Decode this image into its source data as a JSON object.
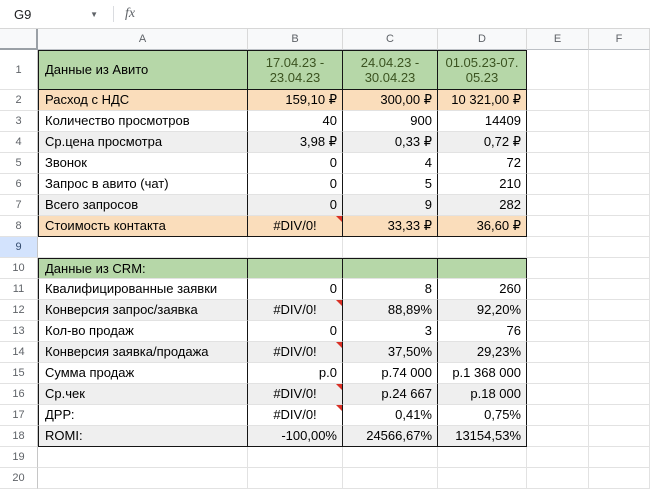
{
  "formula_bar": {
    "cell_reference": "G9",
    "fx_label": "fx"
  },
  "colors": {
    "header_green": "#b6d7a8",
    "highlight_peach": "#faddbb",
    "band_gray": "#efefef",
    "grid_line": "#e2e2e2",
    "selected_row_header": "#d3e3fd",
    "note_red": "#d93025",
    "date_text_green": "#3b5320",
    "block_border": "#151515"
  },
  "sheet": {
    "column_headers": [
      "A",
      "B",
      "C",
      "D",
      "E",
      "F"
    ],
    "selected_row": 9,
    "blocks": [
      {
        "start": 1,
        "end": 8
      },
      {
        "start": 10,
        "end": 18
      }
    ],
    "thick_underline_rows": [
      1
    ],
    "rows": [
      {
        "n": 1,
        "h": 40,
        "cells": {
          "A": {
            "t": "Данные из Авито",
            "bg": "green",
            "al": "l"
          },
          "B": {
            "t": "17.04.23 -\n23.04.23",
            "bg": "green",
            "al": "c",
            "tone": "date"
          },
          "C": {
            "t": "24.04.23 -\n30.04.23",
            "bg": "green",
            "al": "c",
            "tone": "date"
          },
          "D": {
            "t": "01.05.23-07.\n05.23",
            "bg": "green",
            "al": "c",
            "tone": "date"
          }
        }
      },
      {
        "n": 2,
        "cells": {
          "A": {
            "t": "Расход с НДС",
            "bg": "peach",
            "al": "l"
          },
          "B": {
            "t": "159,10 ₽",
            "bg": "peach",
            "al": "r"
          },
          "C": {
            "t": "300,00 ₽",
            "bg": "peach",
            "al": "r"
          },
          "D": {
            "t": "10 321,00 ₽",
            "bg": "peach",
            "al": "r"
          }
        }
      },
      {
        "n": 3,
        "cells": {
          "A": {
            "t": "Количество просмотров",
            "al": "l"
          },
          "B": {
            "t": "40",
            "al": "r"
          },
          "C": {
            "t": "900",
            "al": "r"
          },
          "D": {
            "t": "14409",
            "al": "r"
          }
        }
      },
      {
        "n": 4,
        "cells": {
          "A": {
            "t": "Ср.цена просмотра",
            "bg": "gray",
            "al": "l"
          },
          "B": {
            "t": "3,98 ₽",
            "bg": "gray",
            "al": "r"
          },
          "C": {
            "t": "0,33 ₽",
            "bg": "gray",
            "al": "r"
          },
          "D": {
            "t": "0,72 ₽",
            "bg": "gray",
            "al": "r"
          }
        }
      },
      {
        "n": 5,
        "cells": {
          "A": {
            "t": "Звонок",
            "al": "l"
          },
          "B": {
            "t": "0",
            "al": "r"
          },
          "C": {
            "t": "4",
            "al": "r"
          },
          "D": {
            "t": "72",
            "al": "r"
          }
        }
      },
      {
        "n": 6,
        "cells": {
          "A": {
            "t": "Запрос в авито (чат)",
            "al": "l"
          },
          "B": {
            "t": "0",
            "al": "r"
          },
          "C": {
            "t": "5",
            "al": "r"
          },
          "D": {
            "t": "210",
            "al": "r"
          }
        }
      },
      {
        "n": 7,
        "cells": {
          "A": {
            "t": "Всего запросов",
            "bg": "gray",
            "al": "l"
          },
          "B": {
            "t": "0",
            "bg": "gray",
            "al": "r"
          },
          "C": {
            "t": "9",
            "bg": "gray",
            "al": "r"
          },
          "D": {
            "t": "282",
            "bg": "gray",
            "al": "r"
          }
        }
      },
      {
        "n": 8,
        "cells": {
          "A": {
            "t": "Стоимость контакта",
            "bg": "peach",
            "al": "l"
          },
          "B": {
            "t": "#DIV/0!",
            "bg": "peach",
            "al": "c",
            "note": true
          },
          "C": {
            "t": "33,33 ₽",
            "bg": "peach",
            "al": "r"
          },
          "D": {
            "t": "36,60 ₽",
            "bg": "peach",
            "al": "r"
          }
        }
      },
      {
        "n": 9,
        "cells": {}
      },
      {
        "n": 10,
        "cells": {
          "A": {
            "t": "Данные из CRM:",
            "bg": "green",
            "al": "l"
          },
          "B": {
            "t": "",
            "bg": "green"
          },
          "C": {
            "t": "",
            "bg": "green"
          },
          "D": {
            "t": "",
            "bg": "green"
          }
        }
      },
      {
        "n": 11,
        "cells": {
          "A": {
            "t": "Квалифицированные заявки",
            "al": "l"
          },
          "B": {
            "t": "0",
            "al": "r"
          },
          "C": {
            "t": "8",
            "al": "r"
          },
          "D": {
            "t": "260",
            "al": "r"
          }
        }
      },
      {
        "n": 12,
        "cells": {
          "A": {
            "t": "Конверсия запрос/заявка",
            "bg": "gray",
            "al": "l"
          },
          "B": {
            "t": "#DIV/0!",
            "bg": "gray",
            "al": "c",
            "note": true
          },
          "C": {
            "t": "88,89%",
            "bg": "gray",
            "al": "r"
          },
          "D": {
            "t": "92,20%",
            "bg": "gray",
            "al": "r"
          }
        }
      },
      {
        "n": 13,
        "cells": {
          "A": {
            "t": "Кол-во продаж",
            "al": "l"
          },
          "B": {
            "t": "0",
            "al": "r"
          },
          "C": {
            "t": "3",
            "al": "r"
          },
          "D": {
            "t": "76",
            "al": "r"
          }
        }
      },
      {
        "n": 14,
        "cells": {
          "A": {
            "t": "Конверсия заявка/продажа",
            "bg": "gray",
            "al": "l"
          },
          "B": {
            "t": "#DIV/0!",
            "bg": "gray",
            "al": "c",
            "note": true
          },
          "C": {
            "t": "37,50%",
            "bg": "gray",
            "al": "r"
          },
          "D": {
            "t": "29,23%",
            "bg": "gray",
            "al": "r"
          }
        }
      },
      {
        "n": 15,
        "cells": {
          "A": {
            "t": "Сумма продаж",
            "al": "l"
          },
          "B": {
            "t": "р.0",
            "al": "r"
          },
          "C": {
            "t": "р.74 000",
            "al": "r"
          },
          "D": {
            "t": "р.1 368 000",
            "al": "r"
          }
        }
      },
      {
        "n": 16,
        "cells": {
          "A": {
            "t": "Ср.чек",
            "bg": "gray",
            "al": "l"
          },
          "B": {
            "t": "#DIV/0!",
            "bg": "gray",
            "al": "c",
            "note": true
          },
          "C": {
            "t": "р.24 667",
            "bg": "gray",
            "al": "r"
          },
          "D": {
            "t": "р.18 000",
            "bg": "gray",
            "al": "r"
          }
        }
      },
      {
        "n": 17,
        "cells": {
          "A": {
            "t": "ДРР:",
            "al": "l"
          },
          "B": {
            "t": "#DIV/0!",
            "al": "c",
            "note": true
          },
          "C": {
            "t": "0,41%",
            "al": "r"
          },
          "D": {
            "t": "0,75%",
            "al": "r"
          }
        }
      },
      {
        "n": 18,
        "cells": {
          "A": {
            "t": "ROMI:",
            "bg": "gray",
            "al": "l"
          },
          "B": {
            "t": "-100,00%",
            "bg": "gray",
            "al": "r"
          },
          "C": {
            "t": "24566,67%",
            "bg": "gray",
            "al": "r"
          },
          "D": {
            "t": "13154,53%",
            "bg": "gray",
            "al": "r"
          }
        }
      },
      {
        "n": 19,
        "cells": {}
      },
      {
        "n": 20,
        "cells": {}
      }
    ]
  }
}
